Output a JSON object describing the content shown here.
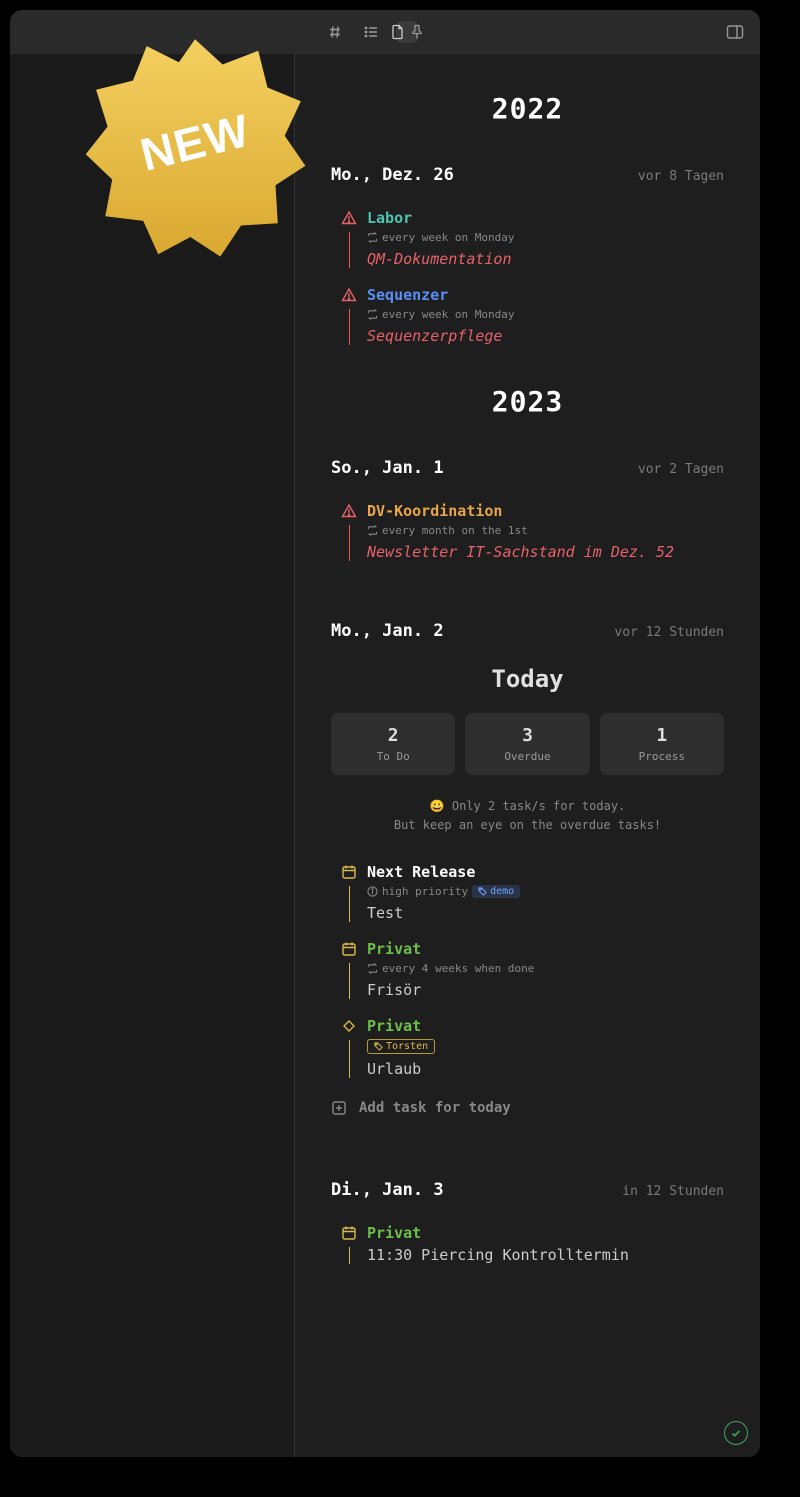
{
  "badge": {
    "text": "NEW"
  },
  "years": {
    "y2022": "2022",
    "y2023": "2023"
  },
  "days": {
    "dec26": {
      "date": "Mo., Dez. 26",
      "rel": "vor 8 Tagen",
      "tasks": [
        {
          "title": "Labor",
          "repeat": "every week on Monday",
          "desc": "QM-Dokumentation"
        },
        {
          "title": "Sequenzer",
          "repeat": "every week on Monday",
          "desc": "Sequenzerpflege"
        }
      ]
    },
    "jan1": {
      "date": "So., Jan. 1",
      "rel": "vor 2 Tagen",
      "tasks": [
        {
          "title": "DV-Koordination",
          "repeat": "every month on the 1st",
          "desc": "Newsletter IT-Sachstand im Dez. 52"
        }
      ]
    },
    "jan2": {
      "date": "Mo., Jan. 2",
      "rel": "vor 12 Stunden"
    },
    "jan3": {
      "date": "Di., Jan. 3",
      "rel": "in 12 Stunden",
      "tasks": [
        {
          "title": "Privat",
          "desc": "11:30 Piercing Kontrolltermin"
        }
      ]
    }
  },
  "today": {
    "header": "Today",
    "stats": [
      {
        "num": "2",
        "label": "To Do"
      },
      {
        "num": "3",
        "label": "Overdue"
      },
      {
        "num": "1",
        "label": "Process"
      }
    ],
    "motivate1": "😀 Only 2 task/s for today.",
    "motivate2": "But keep an eye on the overdue tasks!",
    "tasks": {
      "t0": {
        "title": "Next Release",
        "priority": "high priority",
        "tag": "demo",
        "desc": "Test"
      },
      "t1": {
        "title": "Privat",
        "repeat": "every 4 weeks when done",
        "desc": "Frisör"
      },
      "t2": {
        "title": "Privat",
        "tag": "Torsten",
        "desc": "Urlaub"
      }
    },
    "add": "Add task for today"
  }
}
